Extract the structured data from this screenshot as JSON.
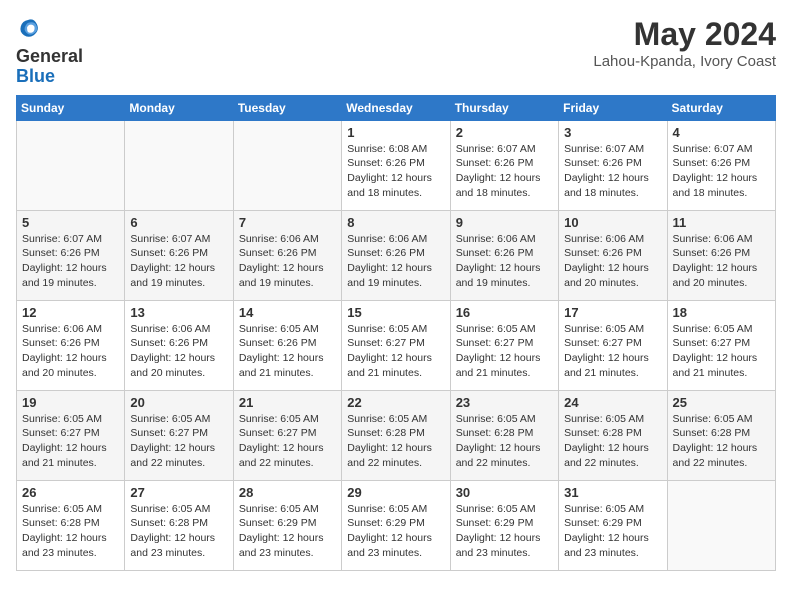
{
  "header": {
    "logo_line1": "General",
    "logo_line2": "Blue",
    "month_year": "May 2024",
    "location": "Lahou-Kpanda, Ivory Coast"
  },
  "weekdays": [
    "Sunday",
    "Monday",
    "Tuesday",
    "Wednesday",
    "Thursday",
    "Friday",
    "Saturday"
  ],
  "weeks": [
    [
      {
        "day": "",
        "info": ""
      },
      {
        "day": "",
        "info": ""
      },
      {
        "day": "",
        "info": ""
      },
      {
        "day": "1",
        "info": "Sunrise: 6:08 AM\nSunset: 6:26 PM\nDaylight: 12 hours\nand 18 minutes."
      },
      {
        "day": "2",
        "info": "Sunrise: 6:07 AM\nSunset: 6:26 PM\nDaylight: 12 hours\nand 18 minutes."
      },
      {
        "day": "3",
        "info": "Sunrise: 6:07 AM\nSunset: 6:26 PM\nDaylight: 12 hours\nand 18 minutes."
      },
      {
        "day": "4",
        "info": "Sunrise: 6:07 AM\nSunset: 6:26 PM\nDaylight: 12 hours\nand 18 minutes."
      }
    ],
    [
      {
        "day": "5",
        "info": "Sunrise: 6:07 AM\nSunset: 6:26 PM\nDaylight: 12 hours\nand 19 minutes."
      },
      {
        "day": "6",
        "info": "Sunrise: 6:07 AM\nSunset: 6:26 PM\nDaylight: 12 hours\nand 19 minutes."
      },
      {
        "day": "7",
        "info": "Sunrise: 6:06 AM\nSunset: 6:26 PM\nDaylight: 12 hours\nand 19 minutes."
      },
      {
        "day": "8",
        "info": "Sunrise: 6:06 AM\nSunset: 6:26 PM\nDaylight: 12 hours\nand 19 minutes."
      },
      {
        "day": "9",
        "info": "Sunrise: 6:06 AM\nSunset: 6:26 PM\nDaylight: 12 hours\nand 19 minutes."
      },
      {
        "day": "10",
        "info": "Sunrise: 6:06 AM\nSunset: 6:26 PM\nDaylight: 12 hours\nand 20 minutes."
      },
      {
        "day": "11",
        "info": "Sunrise: 6:06 AM\nSunset: 6:26 PM\nDaylight: 12 hours\nand 20 minutes."
      }
    ],
    [
      {
        "day": "12",
        "info": "Sunrise: 6:06 AM\nSunset: 6:26 PM\nDaylight: 12 hours\nand 20 minutes."
      },
      {
        "day": "13",
        "info": "Sunrise: 6:06 AM\nSunset: 6:26 PM\nDaylight: 12 hours\nand 20 minutes."
      },
      {
        "day": "14",
        "info": "Sunrise: 6:05 AM\nSunset: 6:26 PM\nDaylight: 12 hours\nand 21 minutes."
      },
      {
        "day": "15",
        "info": "Sunrise: 6:05 AM\nSunset: 6:27 PM\nDaylight: 12 hours\nand 21 minutes."
      },
      {
        "day": "16",
        "info": "Sunrise: 6:05 AM\nSunset: 6:27 PM\nDaylight: 12 hours\nand 21 minutes."
      },
      {
        "day": "17",
        "info": "Sunrise: 6:05 AM\nSunset: 6:27 PM\nDaylight: 12 hours\nand 21 minutes."
      },
      {
        "day": "18",
        "info": "Sunrise: 6:05 AM\nSunset: 6:27 PM\nDaylight: 12 hours\nand 21 minutes."
      }
    ],
    [
      {
        "day": "19",
        "info": "Sunrise: 6:05 AM\nSunset: 6:27 PM\nDaylight: 12 hours\nand 21 minutes."
      },
      {
        "day": "20",
        "info": "Sunrise: 6:05 AM\nSunset: 6:27 PM\nDaylight: 12 hours\nand 22 minutes."
      },
      {
        "day": "21",
        "info": "Sunrise: 6:05 AM\nSunset: 6:27 PM\nDaylight: 12 hours\nand 22 minutes."
      },
      {
        "day": "22",
        "info": "Sunrise: 6:05 AM\nSunset: 6:28 PM\nDaylight: 12 hours\nand 22 minutes."
      },
      {
        "day": "23",
        "info": "Sunrise: 6:05 AM\nSunset: 6:28 PM\nDaylight: 12 hours\nand 22 minutes."
      },
      {
        "day": "24",
        "info": "Sunrise: 6:05 AM\nSunset: 6:28 PM\nDaylight: 12 hours\nand 22 minutes."
      },
      {
        "day": "25",
        "info": "Sunrise: 6:05 AM\nSunset: 6:28 PM\nDaylight: 12 hours\nand 22 minutes."
      }
    ],
    [
      {
        "day": "26",
        "info": "Sunrise: 6:05 AM\nSunset: 6:28 PM\nDaylight: 12 hours\nand 23 minutes."
      },
      {
        "day": "27",
        "info": "Sunrise: 6:05 AM\nSunset: 6:28 PM\nDaylight: 12 hours\nand 23 minutes."
      },
      {
        "day": "28",
        "info": "Sunrise: 6:05 AM\nSunset: 6:29 PM\nDaylight: 12 hours\nand 23 minutes."
      },
      {
        "day": "29",
        "info": "Sunrise: 6:05 AM\nSunset: 6:29 PM\nDaylight: 12 hours\nand 23 minutes."
      },
      {
        "day": "30",
        "info": "Sunrise: 6:05 AM\nSunset: 6:29 PM\nDaylight: 12 hours\nand 23 minutes."
      },
      {
        "day": "31",
        "info": "Sunrise: 6:05 AM\nSunset: 6:29 PM\nDaylight: 12 hours\nand 23 minutes."
      },
      {
        "day": "",
        "info": ""
      }
    ]
  ]
}
